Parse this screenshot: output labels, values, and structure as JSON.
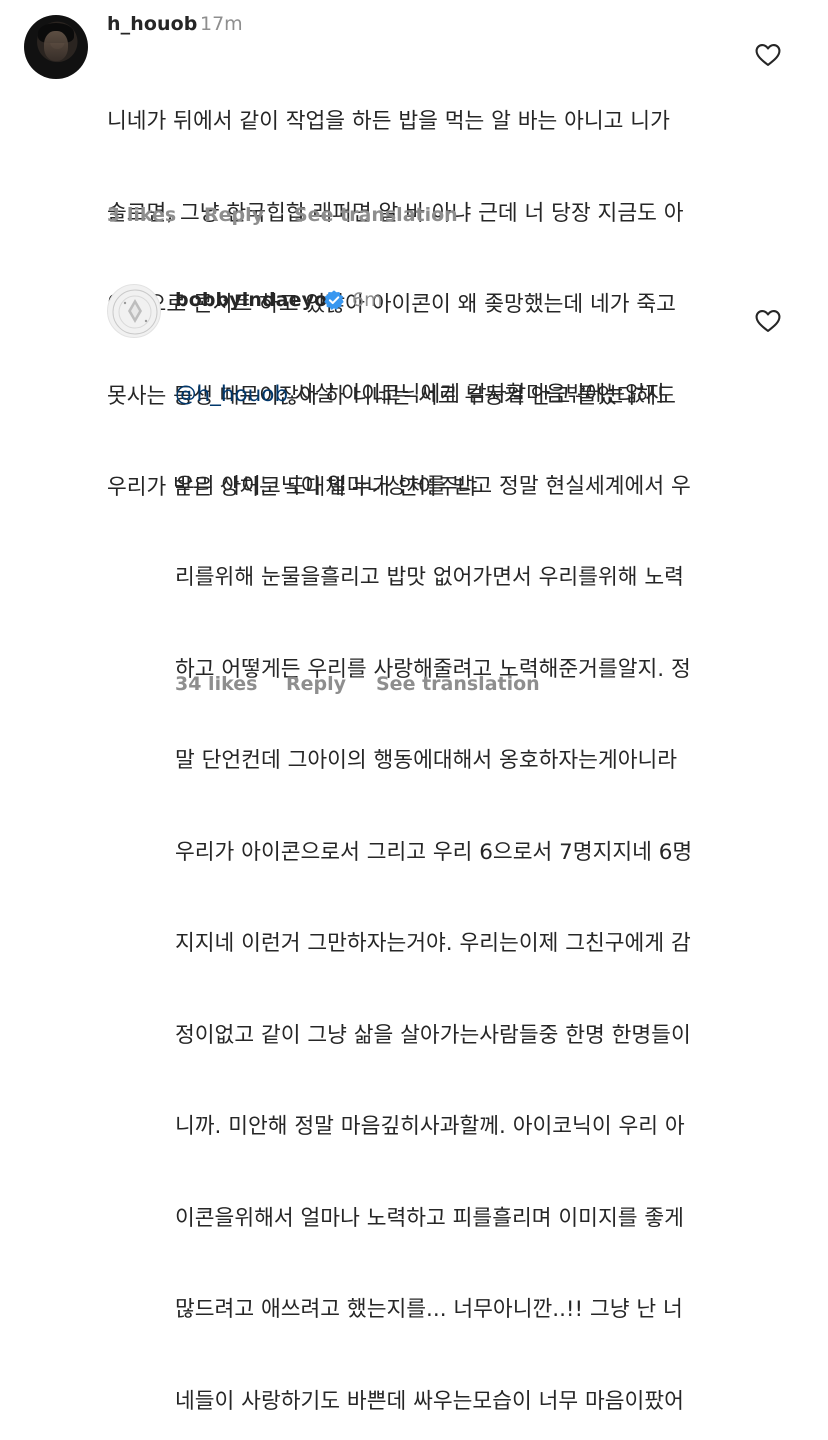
{
  "comments": [
    {
      "username": "h_houob",
      "time": "17m",
      "text_lines": [
        "니네가 뒤에서 같이 작업을 하든 밥을 먹는 알 바는 아니고 니가",
        "솔로면, 그냥 한국힙합 래퍼면 알 바 아냐 근데 너 당장 지금도 아",
        "이콘으로 콘서트 하고 있잖아 아이콘이 왜 좆망했는데 네가 죽고",
        "못사는 동생 때문이잖아 하 니네는 서로 부둥켜 안고 풀었다해도",
        "우리가 받은 상처는 도대체 누가 안아주냐"
      ],
      "likes": "3 likes",
      "reply_label": "Reply",
      "translate_label": "See translation"
    },
    {
      "username": "bobbyindaeyo",
      "verified": true,
      "time": "6m",
      "mention": "@h_houob",
      "first_line_rest": " 사실 아이코닉에게 감사할마음밖에는없지",
      "text_lines": [
        "우리 아이코닉이 얼마나상처를 받고 정말 현실세계에서 우",
        "리를위해 눈물을흘리고 밥맛 없어가면서 우리를위해 노력",
        "하고 어떻게든 우리를 사랑해줄려고 노력해준거를알지. 정",
        "말 단언컨데 그아이의 행동에대해서 옹호하자는게아니라",
        "우리가 아이콘으로서 그리고 우리 6으로서 7명지지네 6명",
        "지지네 이런거 그만하자는거야. 우리는이제 그친구에게 감",
        "정이없고 같이 그냥 삶을 살아가는사람들중 한명 한명들이",
        "니까. 미안해 정말 마음깊히사과할께. 아이코닉이 우리 아",
        "이콘을위해서 얼마나 노력하고 피를흘리며 이미지를 좋게",
        "많드려고 애쓰려고 했는지를... 너무아니깐..!! 그냥 난 너",
        "네들이 사랑하기도 바쁜데 싸우는모습이 너무 마음이팠어"
      ],
      "likes": "34 likes",
      "reply_label": "Reply",
      "translate_label": "See translation"
    }
  ],
  "icons": {
    "like": "heart-outline-icon",
    "verified": "verified-badge-icon"
  },
  "colors": {
    "text": "#262626",
    "secondary": "#8e8e8e",
    "mention": "#00376b",
    "verified": "#3897f0"
  }
}
